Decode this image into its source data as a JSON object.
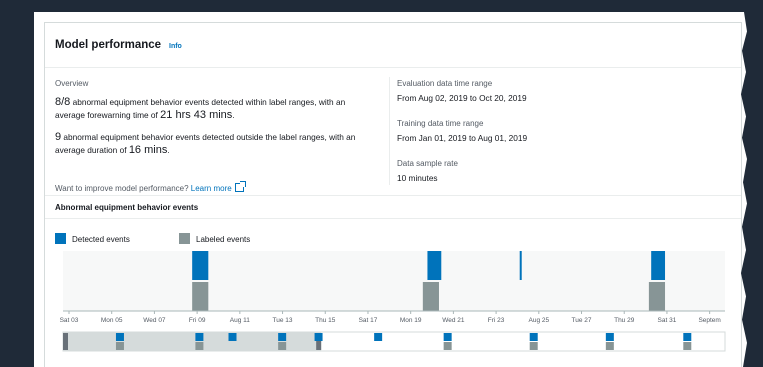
{
  "panel": {
    "title": "Model performance",
    "info_link": "Info"
  },
  "overview": {
    "label": "Overview",
    "line1_count": "8/8",
    "line1_text": " abnormal equipment behavior events detected within label ranges, with an",
    "line2_text": "average forewarning time of ",
    "line2_value": "21 hrs 43 mins",
    "line2_end": ".",
    "line3_count": "9",
    "line3_text": " abnormal equipment behavior events detected outside the label ranges, with an",
    "line4_text": "average duration of ",
    "line4_value": "16 mins",
    "line4_end": ".",
    "improve_text": "Want to improve model performance? ",
    "learn_more": "Learn more"
  },
  "details": {
    "eval_label": "Evaluation data time range",
    "eval_value": "From Aug 02, 2019 to Oct 20, 2019",
    "train_label": "Training data time range",
    "train_value": "From Jan 01, 2019 to Aug 01, 2019",
    "sample_label": "Data sample rate",
    "sample_value": "10 minutes"
  },
  "chart_section": {
    "title": "Abnormal equipment behavior events",
    "legend": [
      {
        "name": "Detected events",
        "color": "#0073bb"
      },
      {
        "name": "Labeled events",
        "color": "#879596"
      }
    ]
  },
  "chart_data": {
    "type": "bar",
    "title": "Abnormal equipment behavior events",
    "x_ticks": [
      "Sat 03",
      "Mon 05",
      "Wed 07",
      "Fri 09",
      "Aug 11",
      "Tue 13",
      "Thu 15",
      "Sat 17",
      "Mon 19",
      "Wed 21",
      "Fri 23",
      "Aug 25",
      "Tue 27",
      "Thu 29",
      "Sat 31",
      "Septem"
    ],
    "x_range_days": [
      0,
      28.7
    ],
    "series": [
      {
        "name": "Detected events",
        "color": "#0073bb",
        "events": [
          {
            "start_day": 5.6,
            "end_day": 6.3
          },
          {
            "start_day": 15.8,
            "end_day": 16.4
          },
          {
            "start_day": 19.8,
            "end_day": 19.85
          },
          {
            "start_day": 25.5,
            "end_day": 26.1
          }
        ]
      },
      {
        "name": "Labeled events",
        "color": "#879596",
        "events": [
          {
            "start_day": 5.6,
            "end_day": 6.3
          },
          {
            "start_day": 15.6,
            "end_day": 16.3
          },
          {
            "start_day": 25.4,
            "end_day": 26.1
          }
        ]
      }
    ],
    "navigator": {
      "selected_fraction": [
        0.0,
        0.39
      ],
      "detected_fractions": [
        0.08,
        0.2,
        0.25,
        0.325,
        0.38,
        0.47,
        0.575,
        0.705,
        0.82,
        0.937
      ],
      "labeled_fractions": [
        0.08,
        0.2,
        0.325,
        0.575,
        0.705,
        0.82,
        0.937
      ]
    }
  }
}
